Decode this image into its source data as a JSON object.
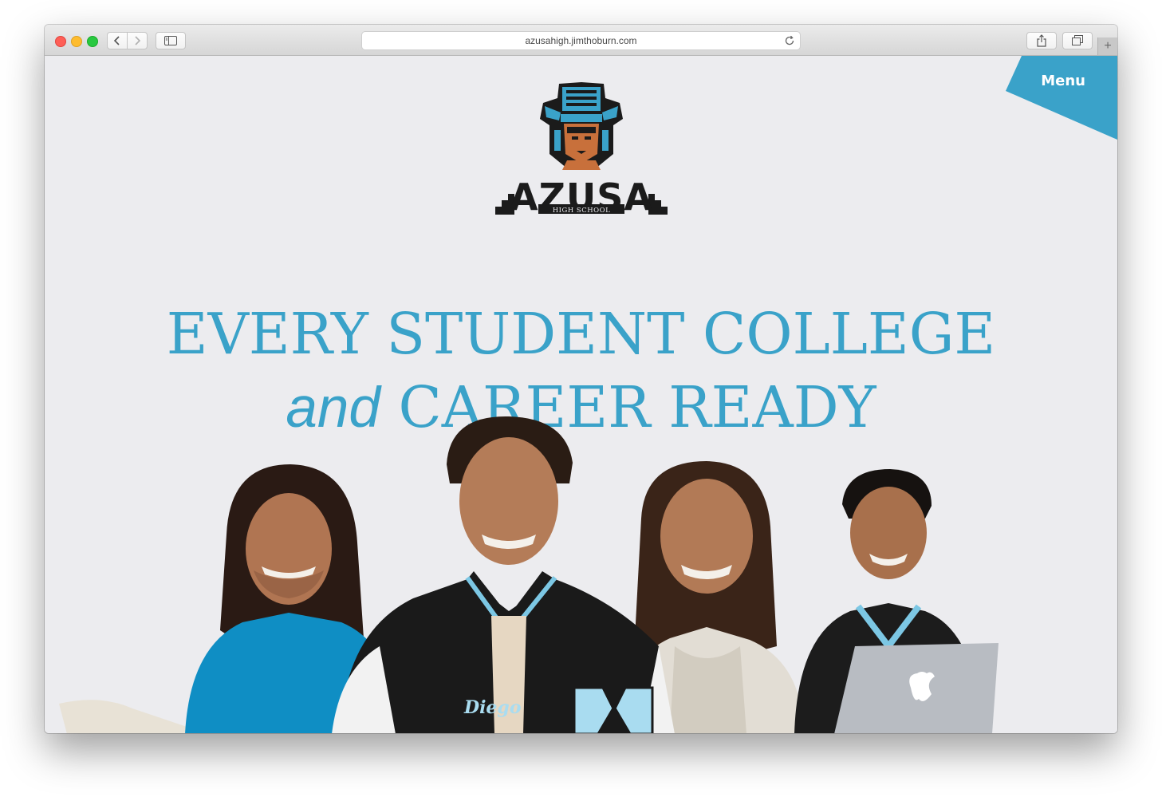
{
  "browser": {
    "url": "azusahigh.jimthoburn.com",
    "new_tab_label": "+"
  },
  "site": {
    "menu_label": "Menu",
    "logo": {
      "wordmark": "AZUSA",
      "subtitle": "HIGH SCHOOL"
    },
    "headline": {
      "line1": "EVERY STUDENT COLLEGE",
      "line2_italic": "and",
      "line2_rest": " CAREER READY"
    },
    "hero_image": {
      "jacket_name": "Diego"
    }
  },
  "colors": {
    "accent": "#3aa2c9",
    "page_bg": "#ececef",
    "menu_tab": "#3aa2c9"
  },
  "icons": [
    "back-icon",
    "forward-icon",
    "sidebar-icon",
    "reload-icon",
    "share-icon",
    "tabs-icon",
    "plus-icon"
  ]
}
